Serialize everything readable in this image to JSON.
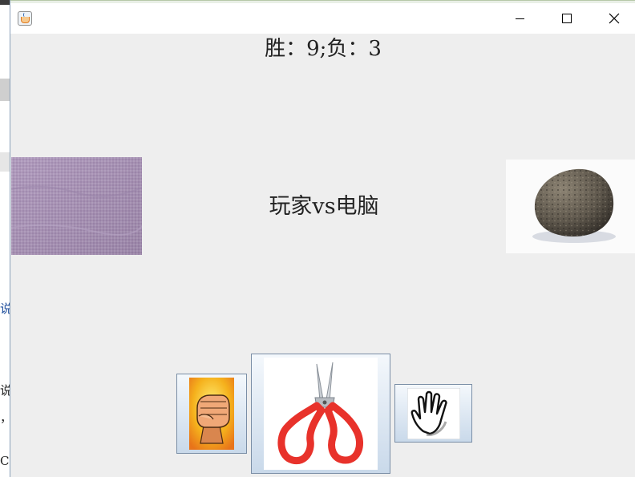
{
  "window": {
    "title": "",
    "controls": [
      "minimize",
      "maximize",
      "close"
    ]
  },
  "score": {
    "text": "胜：9;负：3",
    "wins": 9,
    "losses": 3
  },
  "vs_label": "玩家vs电脑",
  "player_choice": {
    "image": "purple-fabric-texture"
  },
  "computer_choice": {
    "image": "rock"
  },
  "choices": [
    {
      "id": "rock",
      "icon": "fist-icon"
    },
    {
      "id": "scissors",
      "icon": "scissors-icon"
    },
    {
      "id": "paper",
      "icon": "open-hand-icon"
    }
  ],
  "background_app": {
    "visible_chars": [
      "说",
      "说",
      "，",
      "C"
    ]
  },
  "colors": {
    "window_bg": "#eeeeee",
    "titlebar_bg": "#ffffff",
    "button_border": "#7a8ea6",
    "scissors_handle": "#e8322b"
  }
}
